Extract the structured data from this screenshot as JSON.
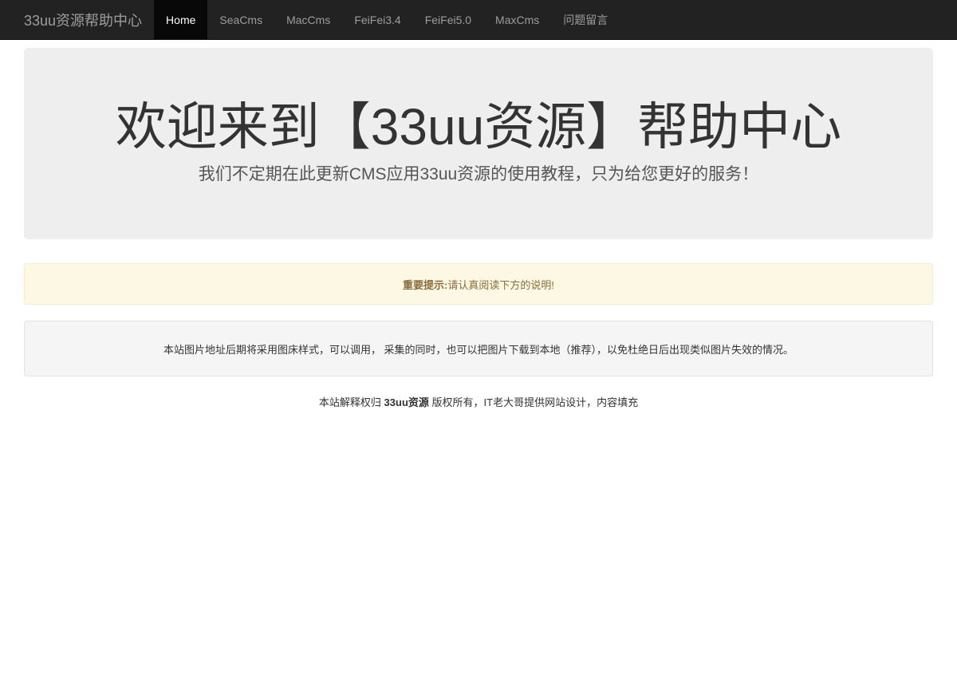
{
  "navbar": {
    "brand": "33uu资源帮助中心",
    "items": [
      {
        "label": "Home",
        "active": true
      },
      {
        "label": "SeaCms",
        "active": false
      },
      {
        "label": "MacCms",
        "active": false
      },
      {
        "label": "FeiFei3.4",
        "active": false
      },
      {
        "label": "FeiFei5.0",
        "active": false
      },
      {
        "label": "MaxCms",
        "active": false
      },
      {
        "label": "问题留言",
        "active": false
      }
    ]
  },
  "jumbotron": {
    "title": "欢迎来到【33uu资源】帮助中心",
    "subtitle": "我们不定期在此更新CMS应用33uu资源的使用教程，只为给您更好的服务！"
  },
  "alert": {
    "label": "重要提示:",
    "text": "请认真阅读下方的说明!"
  },
  "notice": {
    "text": "本站图片地址后期将采用图床样式，可以调用， 采集的同时，也可以把图片下载到本地（推荐），以免杜绝日后出现类似图片失效的情况。"
  },
  "footer": {
    "prefix": "本站解释权归",
    "brand": "33uu资源",
    "suffix": "版权所有，IT老大哥提供网站设计，内容填充"
  },
  "colors": {
    "navbar_bg": "#222222",
    "nav_active_bg": "#080808",
    "jumbotron_bg": "#eeeeee",
    "alert_bg": "#fcf8e3",
    "alert_text": "#8a6d3b"
  }
}
